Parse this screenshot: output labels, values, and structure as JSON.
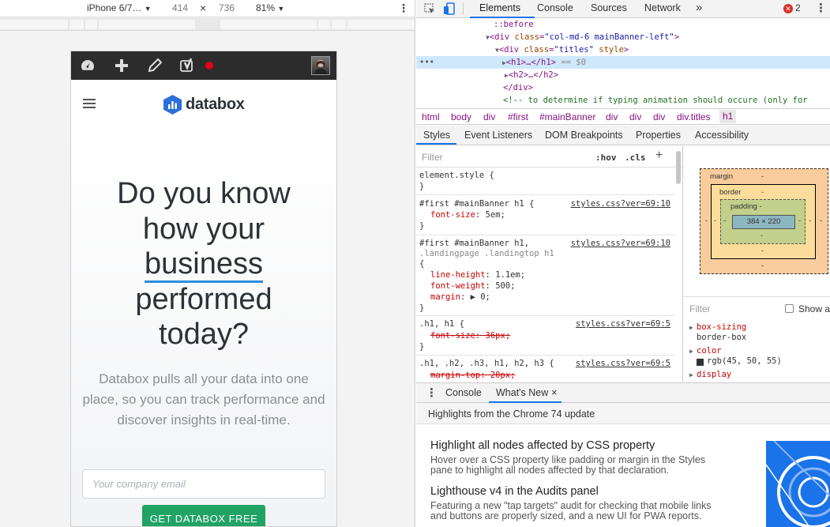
{
  "device_toolbar": {
    "device": "iPhone 6/7…",
    "width": "414",
    "times": "×",
    "height": "736",
    "zoom": "81%"
  },
  "page": {
    "logo_text": "databox",
    "hero_title_line1": "Do you know",
    "hero_title_line2": "how your",
    "hero_title_line3": "business",
    "hero_title_line4": "performed",
    "hero_title_line5": "today?",
    "hero_subtitle": "Databox pulls all your data into one place, so you can track performance and discover insights in real-time.",
    "email_placeholder": "Your company email",
    "cta_label": "GET DATABOX FREE"
  },
  "devtools": {
    "tabs": [
      "Elements",
      "Console",
      "Sources",
      "Network"
    ],
    "more_tabs": "»",
    "error_count": "2",
    "dom_lines": {
      "before": "::before",
      "div1_open": "<div ",
      "div1_attr": "class",
      "div1_val": "\"col-md-6 mainBanner-left\"",
      "div2_attr1": "class",
      "div2_val": "\"titles\"",
      "div2_attr2": "style",
      "h1_line": "<h1>…</h1>",
      "h1_eq": " == $0",
      "h2_line": "<h2>…</h2>",
      "div_close": "</div>",
      "comment": "<!-- to determine if typing animation should occure (only for"
    },
    "breadcrumbs": [
      "html",
      "body",
      "div",
      "#first",
      "#mainBanner",
      "div",
      "div",
      "div",
      "div.titles",
      "h1"
    ],
    "styles_tabs": [
      "Styles",
      "Event Listeners",
      "DOM Breakpoints",
      "Properties",
      "Accessibility"
    ],
    "filter_placeholder": "Filter",
    "hov": ":hov",
    "cls": ".cls",
    "plus": "+",
    "rules": {
      "r0_sel": "element.style {",
      "r0_close": "}",
      "r1_sel": "#first #mainBanner h1 {",
      "r1_src": "styles.css?ver=69:10",
      "r1_p1": "font-size",
      "r1_v1": ": 5em;",
      "r1_close": "}",
      "r2_sel1": "#first #mainBanner h1,",
      "r2_sel2": ".landingpage .landingtop h1",
      "r2_open": "{",
      "r2_src": "styles.css?ver=69:10",
      "r2_p1": "line-height",
      "r2_v1": ": 1.1em;",
      "r2_p2": "font-weight",
      "r2_v2": ": 500;",
      "r2_p3": "margin",
      "r2_v3": ": ▶ 0;",
      "r2_close": "}",
      "r3_sel": ".h1, h1 {",
      "r3_src": "styles.css?ver=69:5",
      "r3_p1": "font-size: 36px;",
      "r3_close": "}",
      "r4_sel": ".h1, .h2, .h3, h1, h2, h3 {",
      "r4_src": "styles.css?ver=69:5",
      "r4_p1": "margin-top: 20px;"
    },
    "box_model": {
      "margin_label": "margin",
      "border_label": "border",
      "padding_label": "padding -",
      "dash": "-",
      "content": "384 × 220"
    },
    "computed": {
      "filter_placeholder": "Filter",
      "show_all": "Show a",
      "p1": "box-sizing",
      "v1": "border-box",
      "p2": "color",
      "v2": "rgb(45, 50, 55)",
      "p3": "display"
    },
    "drawer_tabs": [
      "Console",
      "What's New"
    ],
    "drawer_close": "×",
    "whats_new": {
      "header": "Highlights from the Chrome 74 update",
      "item1_title": "Highlight all nodes affected by CSS property",
      "item1_desc1": "Hover over a CSS property like padding or margin in the Styles",
      "item1_desc2": "pane to highlight all nodes affected by that declaration.",
      "item2_title": "Lighthouse v4 in the Audits panel",
      "item2_desc1": "Featuring a new \"tap targets\" audit for checking that mobile links",
      "item2_desc2": "and buttons are properly sized, and a new UI for PWA reports."
    }
  },
  "colors": {
    "accent": "#1a73e8",
    "cta_green": "#21a366",
    "logo_blue": "#2b6fd9",
    "wp_bar": "#2c2c2c",
    "error_red": "#d93025",
    "title_underline": "#2b8ede"
  }
}
